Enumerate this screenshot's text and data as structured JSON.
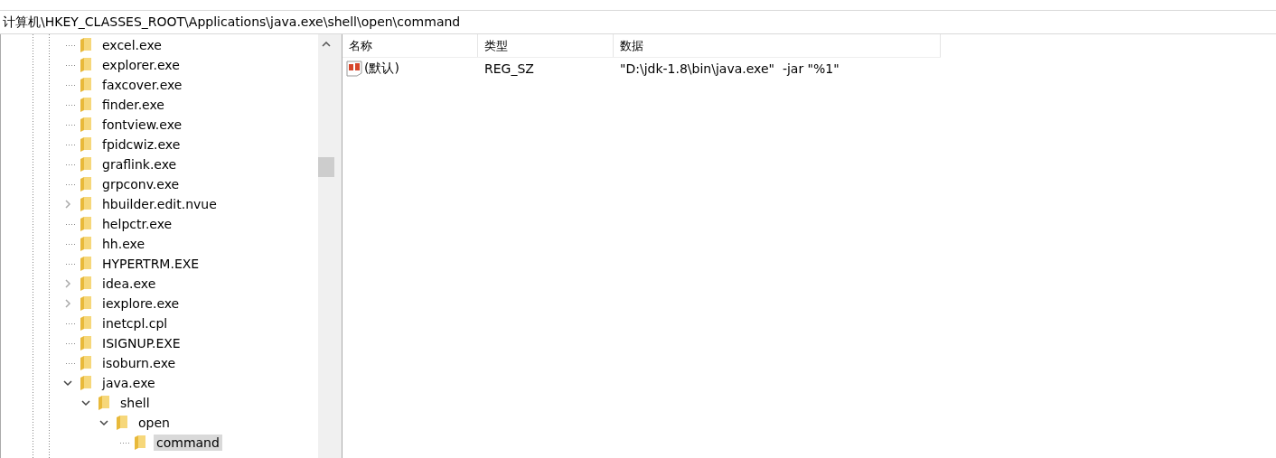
{
  "address_bar": {
    "value": "计算机\\HKEY_CLASSES_ROOT\\Applications\\java.exe\\shell\\open\\command"
  },
  "tree": {
    "items": [
      {
        "label": "excel.exe",
        "kind": "leaf",
        "selected": false
      },
      {
        "label": "explorer.exe",
        "kind": "leaf",
        "selected": false
      },
      {
        "label": "faxcover.exe",
        "kind": "leaf",
        "selected": false
      },
      {
        "label": "finder.exe",
        "kind": "leaf",
        "selected": false
      },
      {
        "label": "fontview.exe",
        "kind": "leaf",
        "selected": false
      },
      {
        "label": "fpidcwiz.exe",
        "kind": "leaf",
        "selected": false
      },
      {
        "label": "graflink.exe",
        "kind": "leaf",
        "selected": false
      },
      {
        "label": "grpconv.exe",
        "kind": "leaf",
        "selected": false
      },
      {
        "label": "hbuilder.edit.nvue",
        "kind": "collapsed",
        "selected": false
      },
      {
        "label": "helpctr.exe",
        "kind": "leaf",
        "selected": false
      },
      {
        "label": "hh.exe",
        "kind": "leaf",
        "selected": false
      },
      {
        "label": "HYPERTRM.EXE",
        "kind": "leaf",
        "selected": false
      },
      {
        "label": "idea.exe",
        "kind": "collapsed",
        "selected": false
      },
      {
        "label": "iexplore.exe",
        "kind": "collapsed",
        "selected": false
      },
      {
        "label": "inetcpl.cpl",
        "kind": "leaf",
        "selected": false
      },
      {
        "label": "ISIGNUP.EXE",
        "kind": "leaf",
        "selected": false
      },
      {
        "label": "isoburn.exe",
        "kind": "leaf",
        "selected": false
      },
      {
        "label": "java.exe",
        "kind": "expanded",
        "selected": false,
        "children": [
          {
            "label": "shell",
            "kind": "expanded",
            "selected": false,
            "children": [
              {
                "label": "open",
                "kind": "expanded",
                "selected": false,
                "children": [
                  {
                    "label": "command",
                    "kind": "leaf",
                    "selected": true
                  }
                ]
              }
            ]
          }
        ]
      }
    ]
  },
  "values_table": {
    "columns": [
      "名称",
      "类型",
      "数据"
    ],
    "rows": [
      {
        "name": "(默认)",
        "type": "REG_SZ",
        "data": "\"D:\\jdk-1.8\\bin\\java.exe\"  -jar \"%1\""
      }
    ]
  }
}
